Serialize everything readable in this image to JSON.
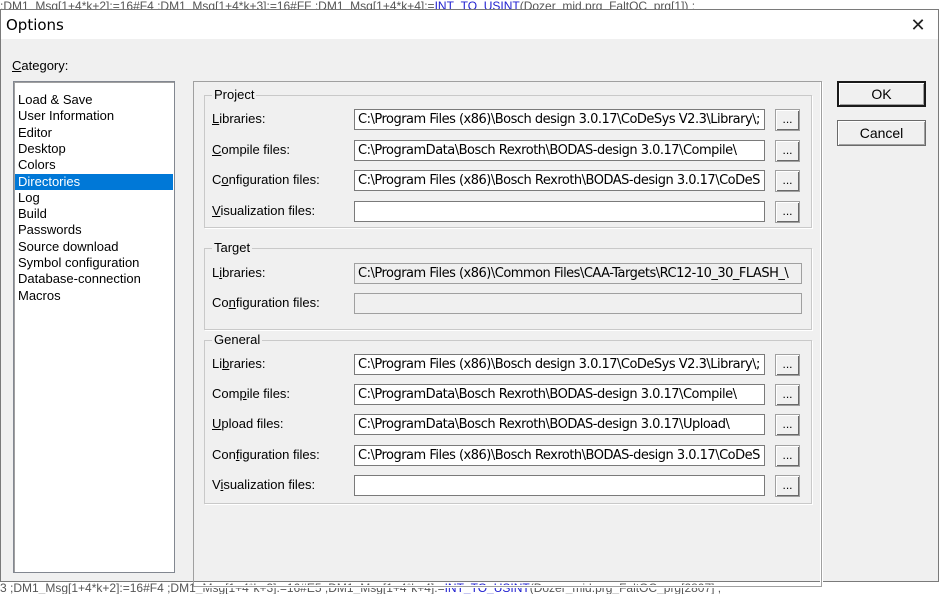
{
  "background": {
    "top_code": ":DM1_Msg[1+4*k+2]:=16#F4 ;DM1_Msg[1+4*k+3]:=16#FF ;DM1_Msg[1+4*k+4]:=",
    "top_code_hl": "INT_TO_USINT",
    "top_code_tail": "(Dozer_mid.prg_FaltOC_prg[1]) ;",
    "bottom_code": "3 ;DM1_Msg[1+4*k+2]:=16#F4 ;DM1_Msg[1+4*k+3]:=16#E5 ;DM1_Msg[1+4*k+4]:=",
    "bottom_code_hl": "INT_TO_USINT",
    "bottom_code_tail": "(Dozer_mid.prg_FaltOC_prg[2807] ;"
  },
  "dialog": {
    "title": "Options",
    "close_glyph": "✕",
    "category_label_first": "C",
    "category_label_rest": "ategory:",
    "categories": [
      "Load & Save",
      "User Information",
      "Editor",
      "Desktop",
      "Colors",
      "Directories",
      "Log",
      "Build",
      "Passwords",
      "Source download",
      "Symbol configuration",
      "Database-connection",
      "Macros"
    ],
    "selected_category": "Directories",
    "buttons": {
      "ok": "OK",
      "cancel": "Cancel"
    },
    "browse_label": "..."
  },
  "project": {
    "title": "Project",
    "libraries": {
      "label_ul": "L",
      "label_rest": "ibraries:",
      "value": "C:\\Program Files (x86)\\Bosch design 3.0.17\\CoDeSys V2.3\\Library\\;"
    },
    "compile": {
      "label_ul": "C",
      "label_rest": "ompile files:",
      "value": "C:\\ProgramData\\Bosch Rexroth\\BODAS-design 3.0.17\\Compile\\"
    },
    "configuration": {
      "label_pre": "C",
      "label_ul": "o",
      "label_rest": "nfiguration files:",
      "value": "C:\\Program Files (x86)\\Bosch Rexroth\\BODAS-design 3.0.17\\CoDeS"
    },
    "visualization": {
      "label_ul": "V",
      "label_rest": "isualization files:",
      "value": ""
    }
  },
  "target": {
    "title": "Target",
    "libraries": {
      "label_pre": "L",
      "label_ul": "i",
      "label_rest": "braries:",
      "value": "C:\\Program Files (x86)\\Common Files\\CAA-Targets\\RC12-10_30_FLASH_\\"
    },
    "configuration": {
      "label_pre": "Co",
      "label_ul": "n",
      "label_rest": "figuration files:",
      "value": ""
    }
  },
  "general": {
    "title": "General",
    "libraries": {
      "label_pre": "Li",
      "label_ul": "b",
      "label_rest": "raries:",
      "value": "C:\\Program Files (x86)\\Bosch design 3.0.17\\CoDeSys V2.3\\Library\\;"
    },
    "compile": {
      "label_pre": "Com",
      "label_ul": "p",
      "label_rest": "ile files:",
      "value": "C:\\ProgramData\\Bosch Rexroth\\BODAS-design 3.0.17\\Compile\\"
    },
    "upload": {
      "label_ul": "U",
      "label_rest": "pload files:",
      "value": "C:\\ProgramData\\Bosch Rexroth\\BODAS-design 3.0.17\\Upload\\"
    },
    "configuration": {
      "label_pre": "Con",
      "label_ul": "f",
      "label_rest": "iguration files:",
      "value": "C:\\Program Files (x86)\\Bosch Rexroth\\BODAS-design 3.0.17\\CoDeS"
    },
    "visualization": {
      "label_pre": "V",
      "label_ul": "i",
      "label_rest": "sualization files:",
      "value": ""
    }
  }
}
